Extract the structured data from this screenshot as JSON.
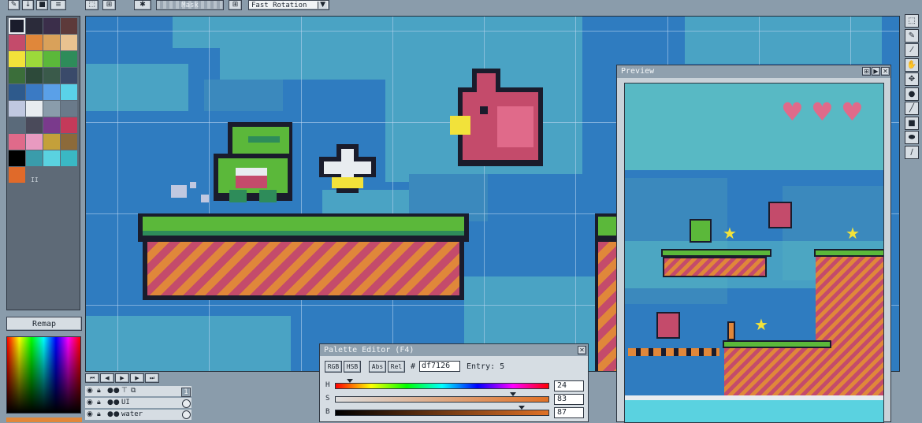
{
  "toolbar": {
    "left_tools": [
      "pen-icon",
      "arrow-down-icon",
      "save-icon",
      "menu-icon"
    ],
    "select_tools": [
      "selection-rect-icon",
      "selection-grid-icon",
      "selection-gear-icon"
    ],
    "mask_label": "Mask",
    "transform_option": "Fast Rotation"
  },
  "palette": {
    "swatches": [
      "#1a1c2c",
      "#2b2b3a",
      "#3b2e4a",
      "#5d3a3a",
      "#c44b6b",
      "#e0873a",
      "#d9a15a",
      "#e8c290",
      "#f2e23a",
      "#9cd93a",
      "#5bb83a",
      "#2e8c5a",
      "#3b6e3a",
      "#2d4a3a",
      "#3a5a4a",
      "#3a4a6a",
      "#2e5a8c",
      "#3a7ac4",
      "#5aa0e8",
      "#5ad2e8",
      "#c0c8e0",
      "#e8ecf0",
      "#8a9cab",
      "#6a7a8a",
      "#5a6a7a",
      "#4a4a5a",
      "#7a3a8c",
      "#c43a5a",
      "#e06a8a",
      "#e89ac0",
      "#c4a03a",
      "#8c6a3a",
      "#000000",
      "#3a9cab",
      "#5ad2e0",
      "#3ab8c4",
      "#e06a2a"
    ],
    "extra_mark": "II",
    "remap_label": "Remap"
  },
  "tools": [
    "selection-icon",
    "pencil-icon",
    "eyedropper-icon",
    "hand-icon",
    "move-icon",
    "fill-icon",
    "line-icon",
    "rect-icon",
    "ellipse-icon",
    "brush-icon"
  ],
  "preview": {
    "title": "Preview",
    "hearts": 3
  },
  "palette_editor": {
    "title": "Palette Editor (F4)",
    "mode_buttons": [
      "RGB",
      "HSB",
      "Abs",
      "Rel"
    ],
    "hash": "#",
    "hex_value": "df7126",
    "entry_label": "Entry: 5",
    "sliders": [
      {
        "label": "H",
        "value": "24",
        "fraction": 0.07
      },
      {
        "label": "S",
        "value": "83",
        "fraction": 0.83
      },
      {
        "label": "B",
        "value": "87",
        "fraction": 0.87
      }
    ]
  },
  "animation_controls": [
    "first-frame-icon",
    "prev-frame-icon",
    "play-icon",
    "next-frame-icon",
    "last-frame-icon"
  ],
  "layers": [
    {
      "name": "",
      "frame": "1"
    },
    {
      "name": "UI",
      "frame": ""
    },
    {
      "name": "water",
      "frame": ""
    }
  ],
  "colors": {
    "accent": "#df7126",
    "sky": "#2f7cc0",
    "grass": "#5bb83a",
    "dirt": "#c44b6b"
  }
}
